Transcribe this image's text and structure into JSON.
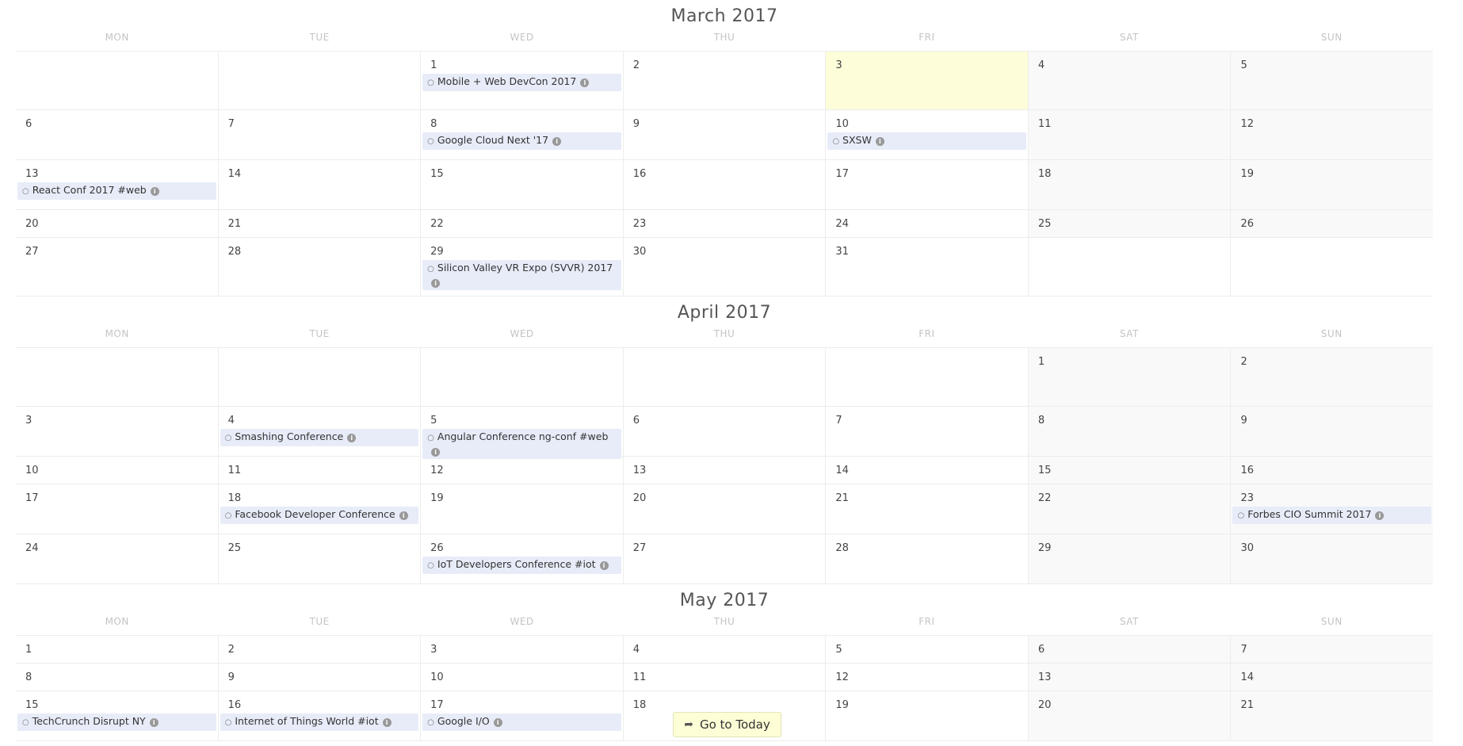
{
  "weekdays": [
    "MON",
    "TUE",
    "WED",
    "THU",
    "FRI",
    "SAT",
    "SUN"
  ],
  "today_button_label": "Go to Today",
  "months": [
    {
      "title": "March 2017",
      "weeks": [
        [
          null,
          null,
          {
            "day": "1",
            "events": [
              "Mobile + Web DevCon 2017"
            ]
          },
          {
            "day": "2"
          },
          {
            "day": "3",
            "today": true
          },
          {
            "day": "4"
          },
          {
            "day": "5"
          }
        ],
        [
          {
            "day": "6"
          },
          {
            "day": "7"
          },
          {
            "day": "8",
            "events": [
              "Google Cloud Next '17"
            ]
          },
          {
            "day": "9"
          },
          {
            "day": "10",
            "events": [
              "SXSW"
            ]
          },
          {
            "day": "11"
          },
          {
            "day": "12"
          }
        ],
        [
          {
            "day": "13",
            "events": [
              "React Conf 2017 #web"
            ]
          },
          {
            "day": "14"
          },
          {
            "day": "15"
          },
          {
            "day": "16"
          },
          {
            "day": "17"
          },
          {
            "day": "18"
          },
          {
            "day": "19"
          }
        ],
        [
          {
            "day": "20"
          },
          {
            "day": "21"
          },
          {
            "day": "22"
          },
          {
            "day": "23"
          },
          {
            "day": "24"
          },
          {
            "day": "25"
          },
          {
            "day": "26"
          }
        ],
        [
          {
            "day": "27"
          },
          {
            "day": "28"
          },
          {
            "day": "29",
            "events": [
              "Silicon Valley VR Expo (SVVR) 2017"
            ]
          },
          {
            "day": "30"
          },
          {
            "day": "31"
          },
          null,
          null
        ]
      ]
    },
    {
      "title": "April 2017",
      "weeks": [
        [
          null,
          null,
          null,
          null,
          null,
          {
            "day": "1"
          },
          {
            "day": "2"
          }
        ],
        [
          {
            "day": "3"
          },
          {
            "day": "4",
            "events": [
              "Smashing Conference"
            ]
          },
          {
            "day": "5",
            "events": [
              "Angular Conference ng-conf #web"
            ]
          },
          {
            "day": "6"
          },
          {
            "day": "7"
          },
          {
            "day": "8"
          },
          {
            "day": "9"
          }
        ],
        [
          {
            "day": "10"
          },
          {
            "day": "11"
          },
          {
            "day": "12"
          },
          {
            "day": "13"
          },
          {
            "day": "14"
          },
          {
            "day": "15"
          },
          {
            "day": "16"
          }
        ],
        [
          {
            "day": "17"
          },
          {
            "day": "18",
            "events": [
              "Facebook Developer Conference"
            ]
          },
          {
            "day": "19"
          },
          {
            "day": "20"
          },
          {
            "day": "21"
          },
          {
            "day": "22"
          },
          {
            "day": "23",
            "events": [
              "Forbes CIO Summit 2017"
            ]
          }
        ],
        [
          {
            "day": "24"
          },
          {
            "day": "25"
          },
          {
            "day": "26",
            "events": [
              "IoT Developers Conference #iot"
            ]
          },
          {
            "day": "27"
          },
          {
            "day": "28"
          },
          {
            "day": "29"
          },
          {
            "day": "30"
          }
        ]
      ]
    },
    {
      "title": "May 2017",
      "weeks": [
        [
          {
            "day": "1"
          },
          {
            "day": "2"
          },
          {
            "day": "3"
          },
          {
            "day": "4"
          },
          {
            "day": "5"
          },
          {
            "day": "6"
          },
          {
            "day": "7"
          }
        ],
        [
          {
            "day": "8"
          },
          {
            "day": "9"
          },
          {
            "day": "10"
          },
          {
            "day": "11"
          },
          {
            "day": "12"
          },
          {
            "day": "13"
          },
          {
            "day": "14"
          }
        ],
        [
          {
            "day": "15",
            "events": [
              "TechCrunch Disrupt NY"
            ]
          },
          {
            "day": "16",
            "events": [
              "Internet of Things World #iot"
            ]
          },
          {
            "day": "17",
            "events": [
              "Google I/O"
            ]
          },
          {
            "day": "18"
          },
          {
            "day": "19"
          },
          {
            "day": "20"
          },
          {
            "day": "21"
          }
        ]
      ]
    }
  ],
  "colors": {
    "today_bg": "#fdfdd9",
    "event_bg": "#e7ecf8",
    "weekend_bg": "#f9f9f9",
    "button_bg": "#fefed6"
  },
  "icons": {
    "event_bullet": "circle-bullet-icon",
    "event_info": "info-icon",
    "today_button": "share-arrow-icon"
  }
}
